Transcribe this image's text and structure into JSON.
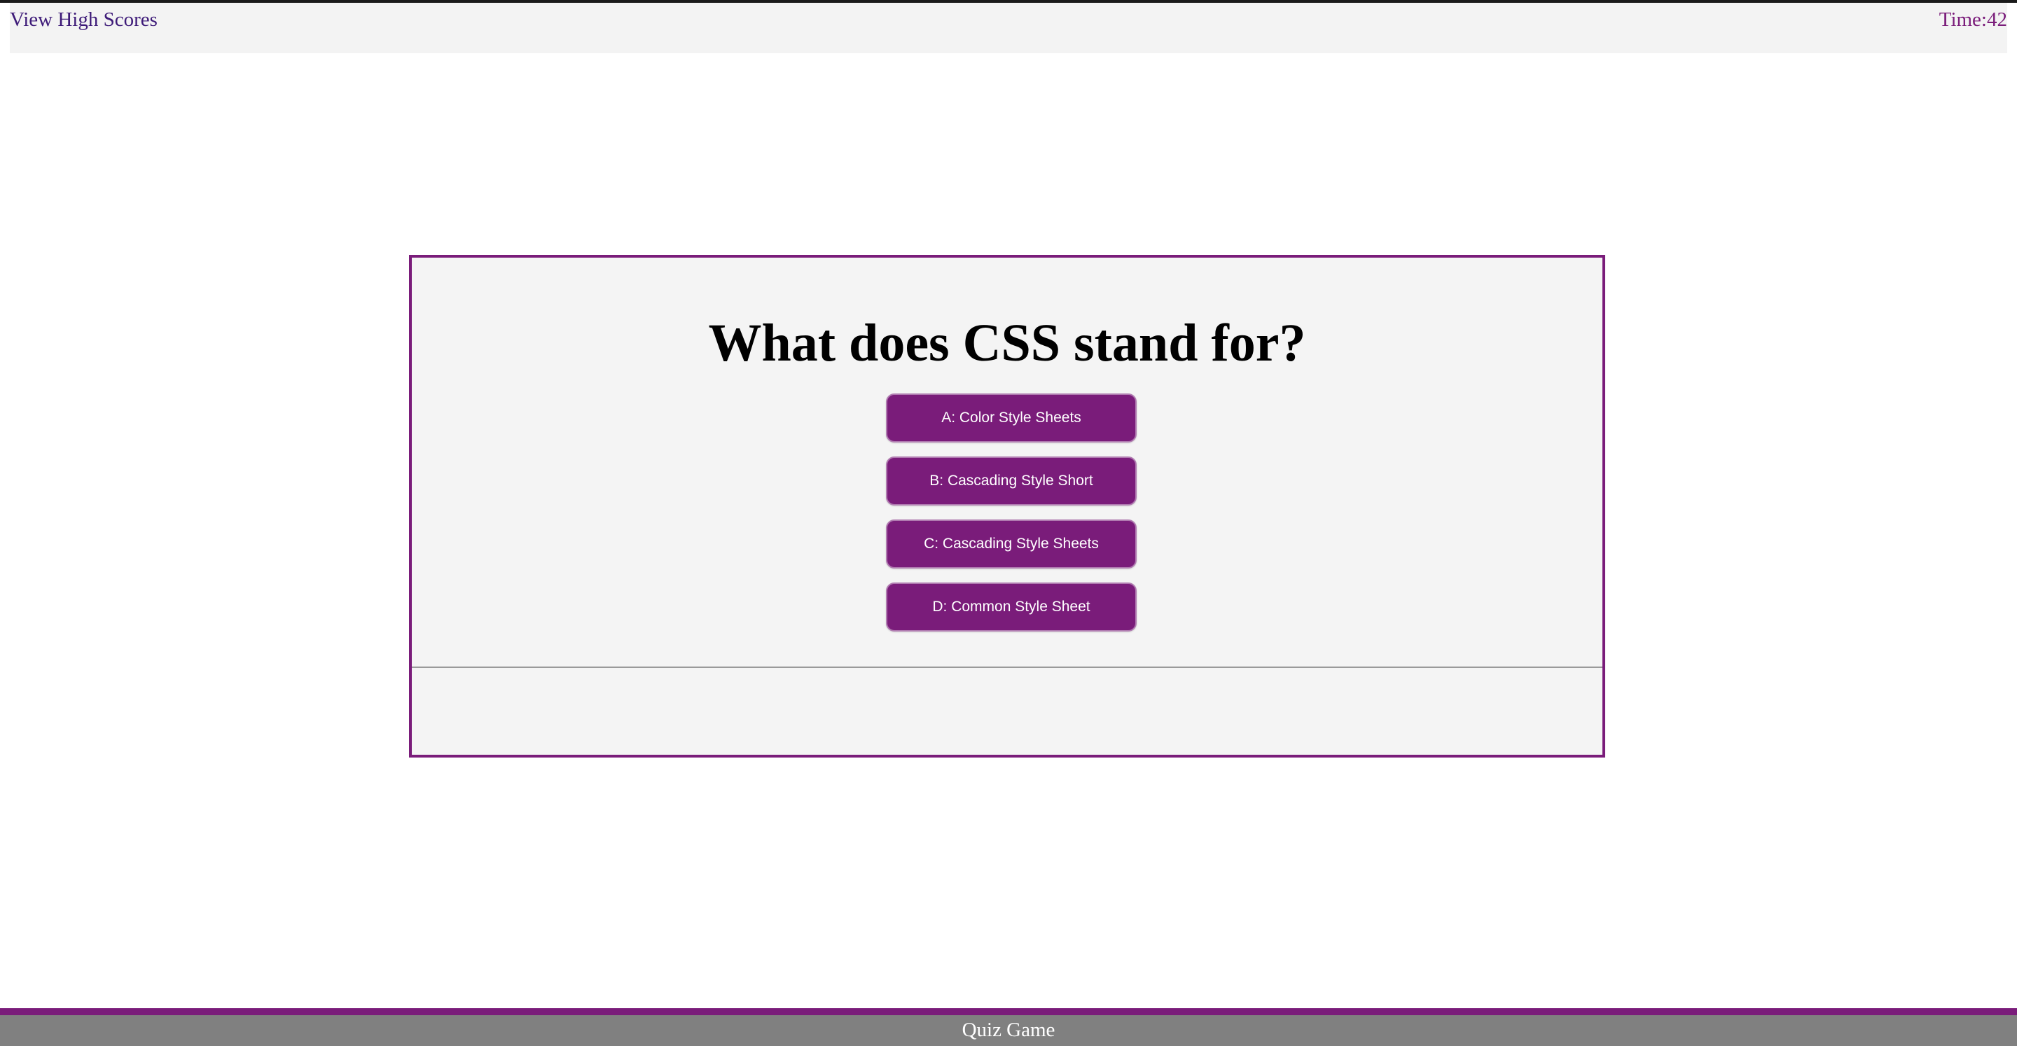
{
  "header": {
    "high_scores_label": "View High Scores",
    "timer_label": "Time:",
    "timer_value": "42"
  },
  "quiz": {
    "question": "What does CSS stand for?",
    "answers": [
      {
        "label": "A: Color Style Sheets"
      },
      {
        "label": "B: Cascading Style Short"
      },
      {
        "label": "C: Cascading Style Sheets"
      },
      {
        "label": "D: Common Style Sheet"
      }
    ],
    "result": ""
  },
  "footer": {
    "title": "Quiz Game"
  },
  "colors": {
    "accent": "#7a1c7a",
    "link": "#3d1a78",
    "card_background": "#f4f4f4",
    "header_background": "#f3f3f3",
    "footer_background": "#808080"
  }
}
